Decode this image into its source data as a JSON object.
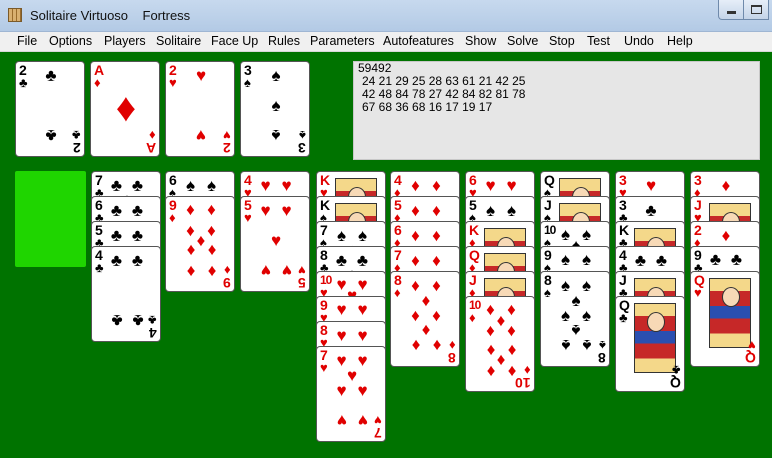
{
  "window": {
    "title": "Solitaire Virtuoso",
    "game": "Fortress"
  },
  "menu": [
    "File",
    "Options",
    "Players",
    "Solitaire",
    "Face Up",
    "Rules",
    "Parameters",
    "Autofeatures",
    "Show",
    "Solve",
    "Stop",
    "Test",
    "Undo",
    "Help"
  ],
  "info": {
    "game_number": "59492",
    "lines": [
      "24 21 29 25 28 63 61 21 42 25",
      "42 48 84 78 27 42 84 82 81 78",
      "67 68 36 68 16 17 19 17"
    ]
  },
  "foundations": [
    {
      "rank": "2",
      "suit": "clubs"
    },
    {
      "rank": "A",
      "suit": "diamonds"
    },
    {
      "rank": "2",
      "suit": "hearts"
    },
    {
      "rank": "3",
      "suit": "spades"
    }
  ],
  "tableau": [
    [
      {
        "rank": "7",
        "suit": "clubs"
      },
      {
        "rank": "6",
        "suit": "clubs"
      },
      {
        "rank": "5",
        "suit": "clubs"
      },
      {
        "rank": "4",
        "suit": "clubs"
      }
    ],
    [
      {
        "rank": "6",
        "suit": "spades"
      },
      {
        "rank": "9",
        "suit": "diamonds"
      }
    ],
    [
      {
        "rank": "4",
        "suit": "hearts"
      },
      {
        "rank": "5",
        "suit": "hearts"
      }
    ],
    [
      {
        "rank": "K",
        "suit": "hearts"
      },
      {
        "rank": "K",
        "suit": "spades"
      },
      {
        "rank": "7",
        "suit": "spades"
      },
      {
        "rank": "8",
        "suit": "clubs"
      },
      {
        "rank": "10",
        "suit": "hearts"
      },
      {
        "rank": "9",
        "suit": "hearts"
      },
      {
        "rank": "8",
        "suit": "hearts"
      },
      {
        "rank": "7",
        "suit": "hearts"
      }
    ],
    [
      {
        "rank": "4",
        "suit": "diamonds"
      },
      {
        "rank": "5",
        "suit": "diamonds"
      },
      {
        "rank": "6",
        "suit": "diamonds"
      },
      {
        "rank": "7",
        "suit": "diamonds"
      },
      {
        "rank": "8",
        "suit": "diamonds"
      }
    ],
    [
      {
        "rank": "6",
        "suit": "hearts"
      },
      {
        "rank": "5",
        "suit": "spades"
      },
      {
        "rank": "K",
        "suit": "diamonds"
      },
      {
        "rank": "Q",
        "suit": "diamonds"
      },
      {
        "rank": "J",
        "suit": "diamonds"
      },
      {
        "rank": "10",
        "suit": "diamonds"
      }
    ],
    [
      {
        "rank": "Q",
        "suit": "spades"
      },
      {
        "rank": "J",
        "suit": "spades"
      },
      {
        "rank": "10",
        "suit": "spades"
      },
      {
        "rank": "9",
        "suit": "spades"
      },
      {
        "rank": "8",
        "suit": "spades"
      }
    ],
    [
      {
        "rank": "3",
        "suit": "hearts"
      },
      {
        "rank": "3",
        "suit": "clubs"
      },
      {
        "rank": "K",
        "suit": "clubs"
      },
      {
        "rank": "4",
        "suit": "clubs"
      },
      {
        "rank": "J",
        "suit": "clubs"
      },
      {
        "rank": "Q",
        "suit": "clubs"
      }
    ],
    [
      {
        "rank": "3",
        "suit": "diamonds"
      },
      {
        "rank": "J",
        "suit": "hearts"
      },
      {
        "rank": "2",
        "suit": "diamonds"
      },
      {
        "rank": "9",
        "suit": "clubs"
      },
      {
        "rank": "Q",
        "suit": "hearts"
      }
    ]
  ],
  "colors": {
    "felt": "#007300",
    "empty_slot": "#1fd500",
    "red_suit": "#e00000",
    "black_suit": "#000000"
  }
}
